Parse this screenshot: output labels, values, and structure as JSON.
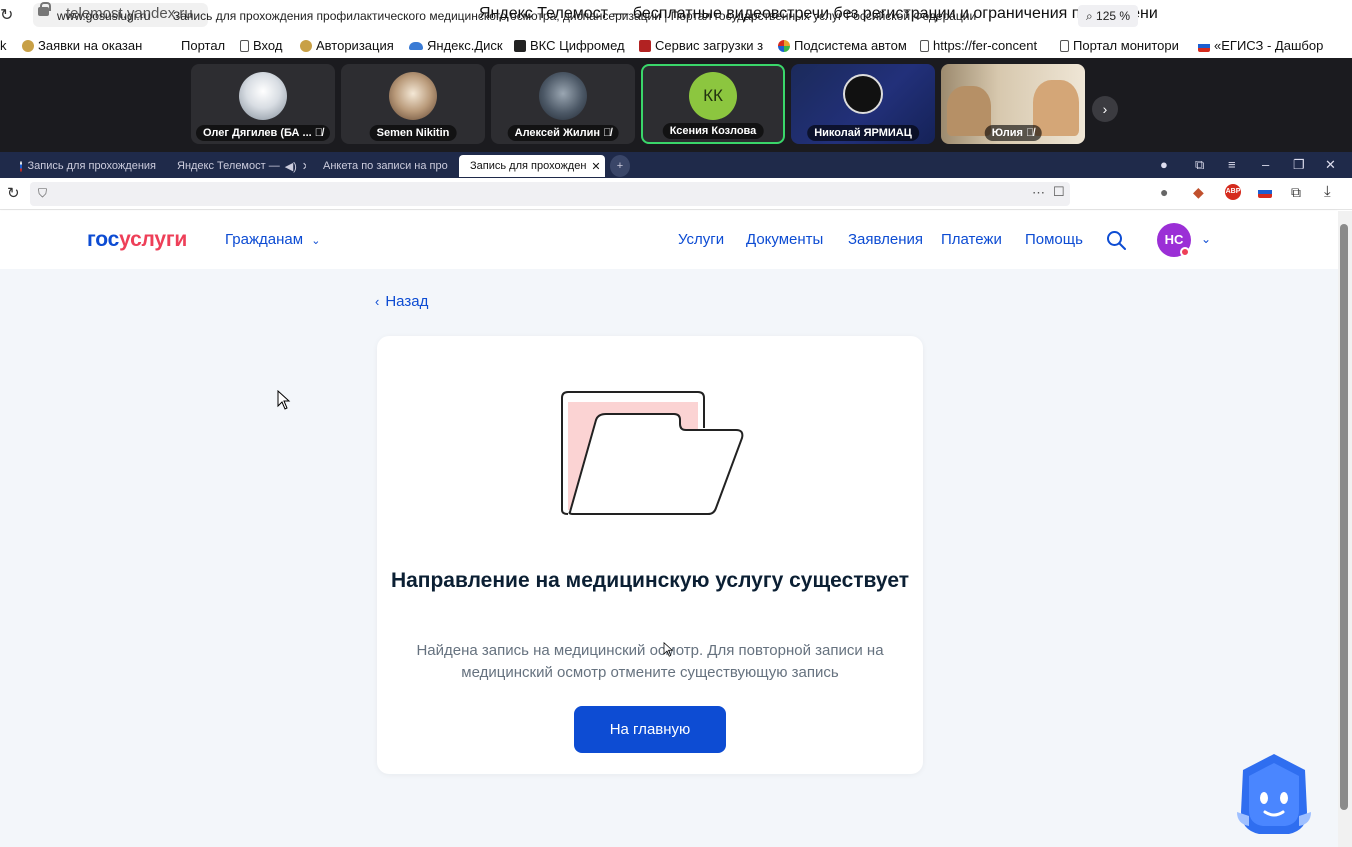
{
  "outer_browser": {
    "url": "telemost.yandex.ru",
    "title": "Яндекс Телемост — бесплатные видеовстречи без регистрации и ограничения по времени"
  },
  "bookmarks": [
    {
      "label": "k",
      "color": "#ffffff"
    },
    {
      "label": "Заявки на оказан",
      "color": "#c8a046"
    },
    {
      "label": "Портал",
      "color": "#ffffff"
    },
    {
      "label": "Вход",
      "color": "#ffffff"
    },
    {
      "label": "Авторизация",
      "color": "#c8a046"
    },
    {
      "label": "Яндекс.Диск",
      "color": "#3a7bd5"
    },
    {
      "label": "ВКС Цифромед",
      "color": "#222222"
    },
    {
      "label": "Сервис загрузки з",
      "color": "#b22222"
    },
    {
      "label": "Подсистема автом",
      "color": "#e9a12a"
    },
    {
      "label": "https://fer-concent",
      "color": "#ffffff"
    },
    {
      "label": "Портал монитори",
      "color": "#ffffff"
    },
    {
      "label": "«ЕГИСЗ - Дашбор",
      "color": "#1c5fd1"
    }
  ],
  "participants": [
    {
      "name": "Олег Дягилев (БА ...",
      "color": "#d8dde3",
      "muted": true,
      "initials": ""
    },
    {
      "name": "Semen Nikitin",
      "color": "#b99a7a",
      "muted": false,
      "initials": ""
    },
    {
      "name": "Алексей Жилин",
      "color": "#4c5866",
      "muted": true,
      "initials": ""
    },
    {
      "name": "Ксения Козлова",
      "color": "#8cc63f",
      "muted": false,
      "initials": "КК"
    },
    {
      "name": "Николай ЯРМИАЦ",
      "color": "#111111",
      "muted": false,
      "initials": ""
    },
    {
      "name": "Юлия",
      "color": "#c9b79c",
      "muted": true,
      "initials": ""
    }
  ],
  "inner_tabs": [
    {
      "label": "Запись для прохождения"
    },
    {
      "label": "Яндекс Телемост —"
    },
    {
      "label": "Анкета по записи на про"
    },
    {
      "label": "Запись для прохожден"
    }
  ],
  "inner_browser": {
    "domain": "www.gosuslugi.ru",
    "title": "Запись для прохождения профилактического медицинского осмотра, диспансеризации | Портал государственных услуг Российской Федерации",
    "zoom": "125 %"
  },
  "header": {
    "logo_part1": "гос",
    "logo_part2": "услуги",
    "citizens": "Гражданам",
    "nav": [
      "Услуги",
      "Документы",
      "Заявления",
      "Платежи",
      "Помощь"
    ],
    "avatar_initials": "НС"
  },
  "main": {
    "back": "Назад",
    "heading": "Направление на медицинскую услугу существует",
    "description": "Найдена запись на медицинский осмотр. Для повторной записи на медицинский осмотр отмените существующую запись",
    "home_button": "На главную"
  },
  "colors": {
    "brand_blue": "#0d4cd3",
    "brand_red": "#ee3f58",
    "active_speaker": "#3ad66a"
  }
}
